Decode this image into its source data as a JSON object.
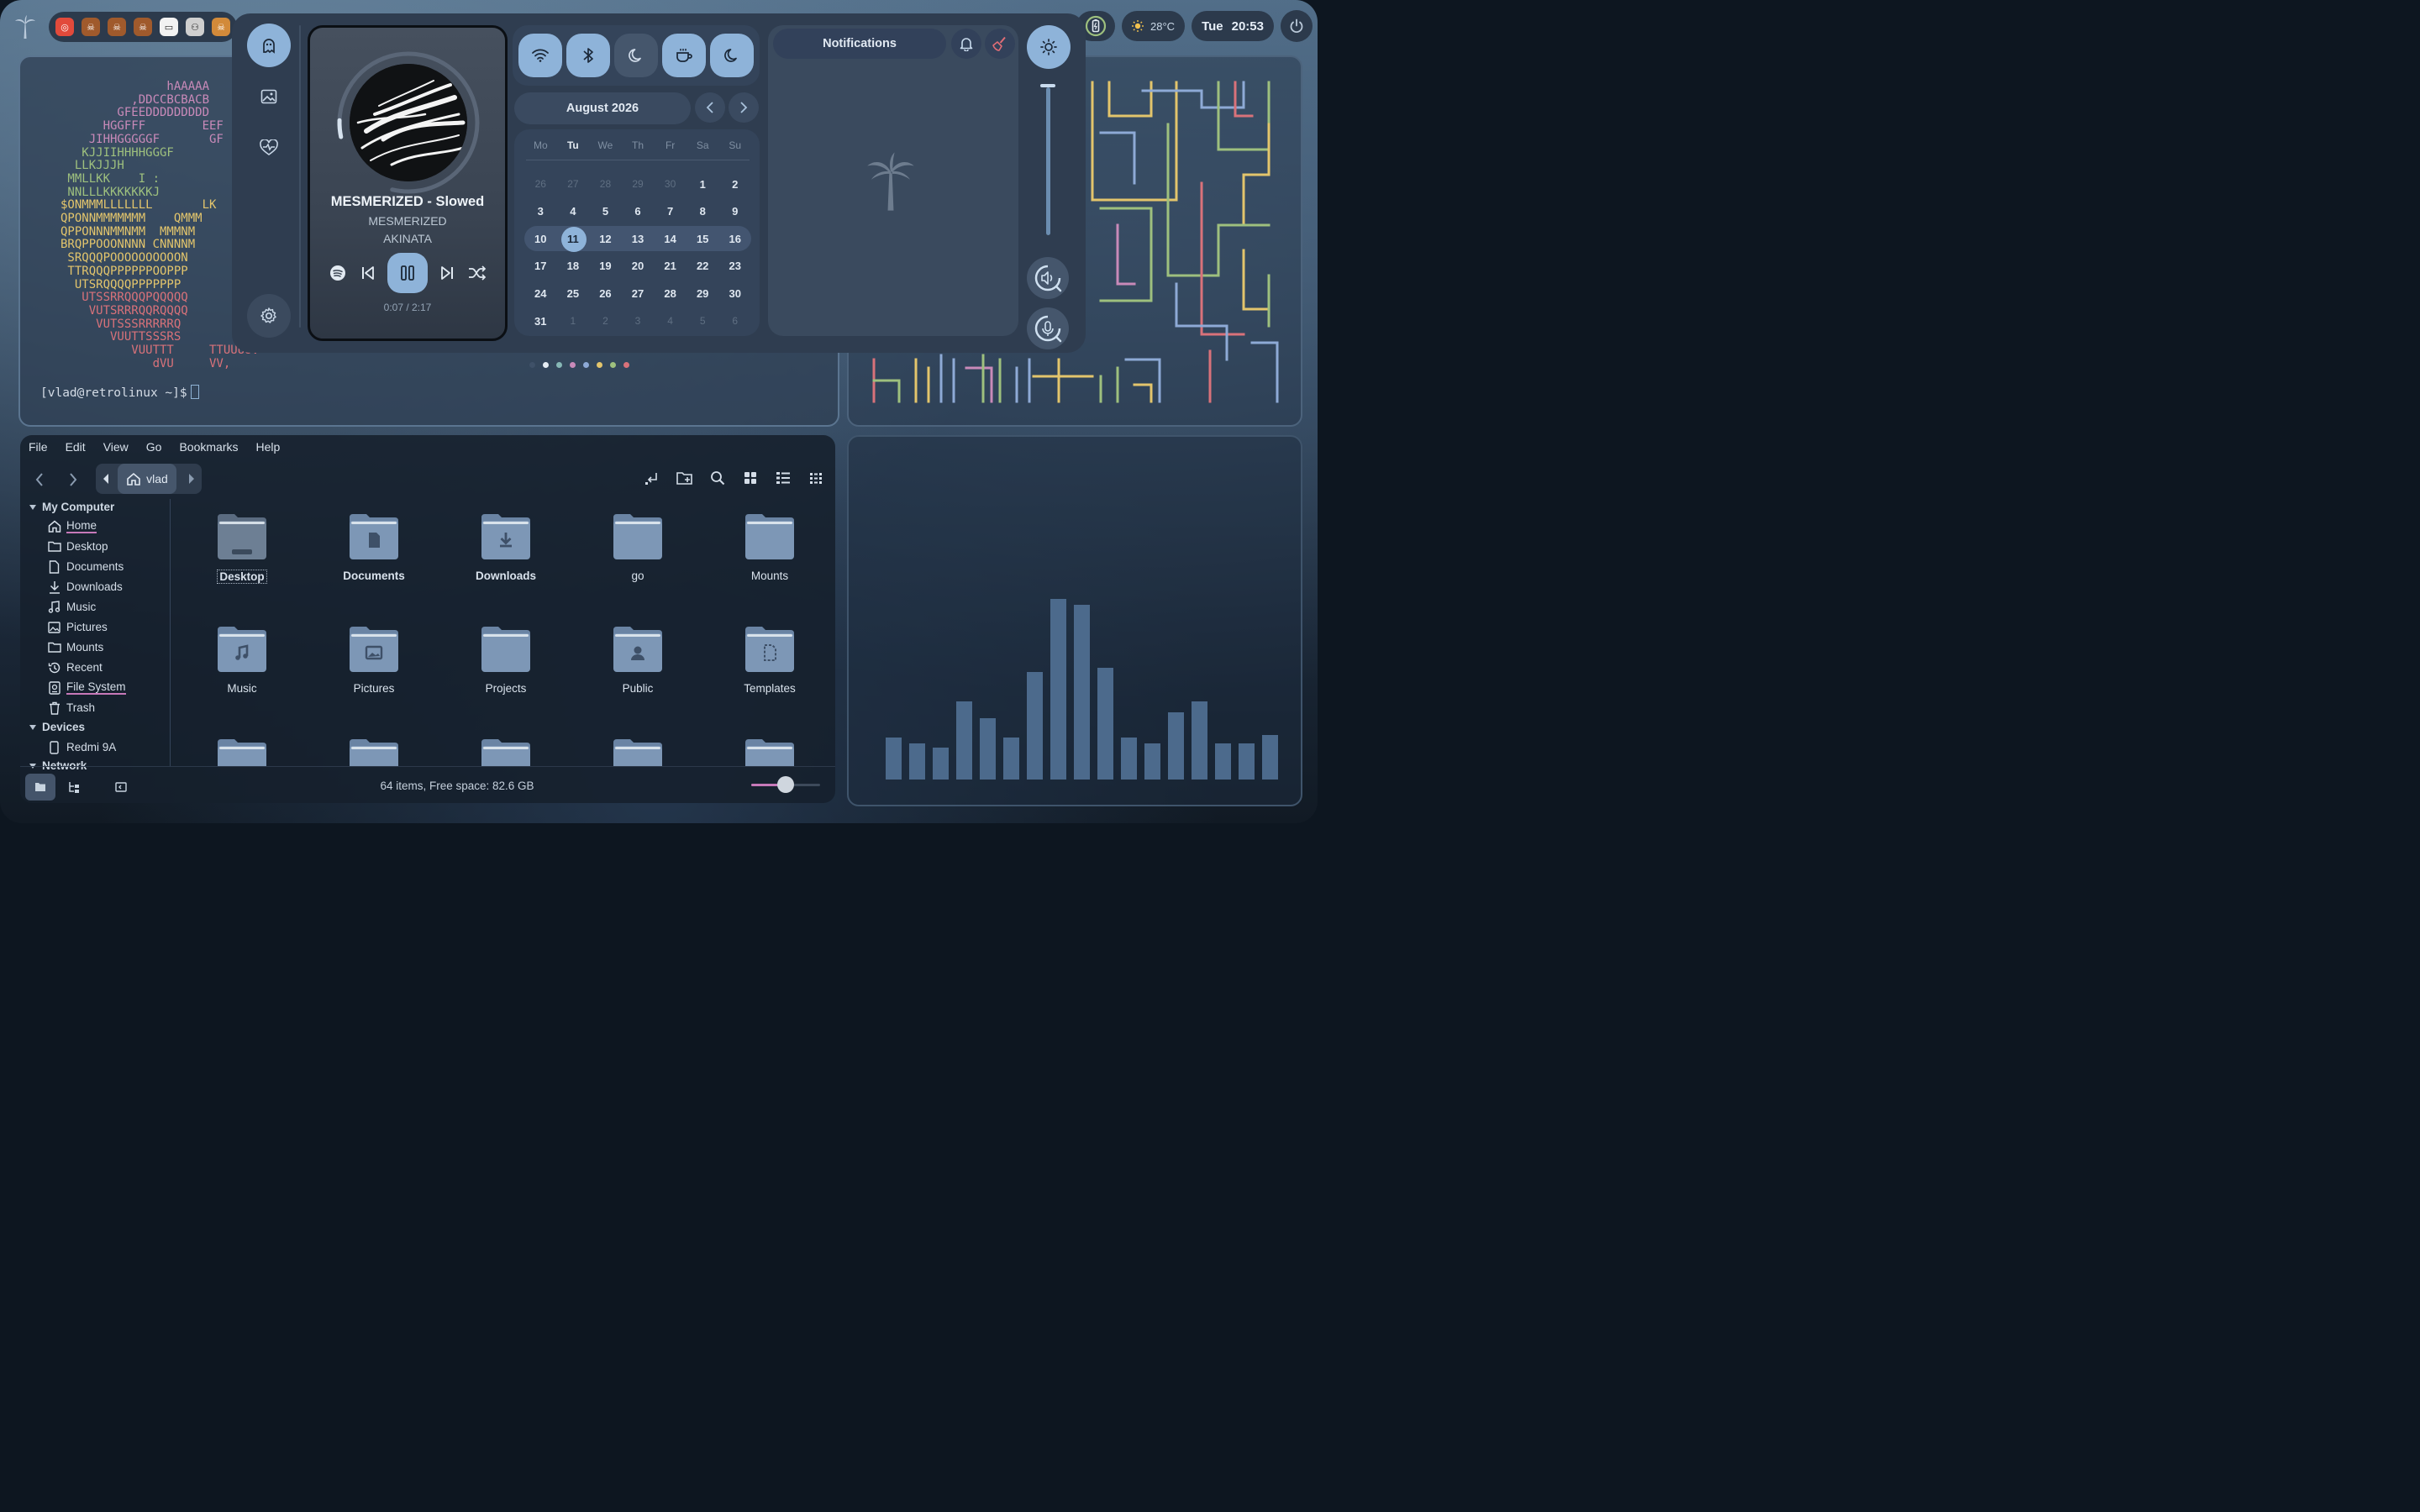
{
  "topbar": {
    "tray_apps": [
      {
        "name": "app-1",
        "color": "#e24a3b",
        "glyph": "◎"
      },
      {
        "name": "app-2",
        "color": "#a05a2c",
        "glyph": "☠"
      },
      {
        "name": "app-3",
        "color": "#a05a2c",
        "glyph": "☠"
      },
      {
        "name": "app-4",
        "color": "#a05a2c",
        "glyph": "☠"
      },
      {
        "name": "app-5",
        "color": "#f2f2f2",
        "glyph": "▭"
      },
      {
        "name": "app-6",
        "color": "#cfcfcf",
        "glyph": "⚇"
      },
      {
        "name": "app-7",
        "color": "#d28a3a",
        "glyph": "☠"
      }
    ],
    "weather": {
      "icon": "sun-icon",
      "temp": "28°C"
    },
    "clock": {
      "day": "Tue",
      "time": "20:53"
    }
  },
  "terminal": {
    "ascii_lines": [
      {
        "text": "               hAAAAA",
        "color": "#c98ab9"
      },
      {
        "text": "          ,DDCCBCBACB",
        "color": "#c98ab9"
      },
      {
        "text": "        GFEEDDDDDDDDD",
        "color": "#c98ab9"
      },
      {
        "text": "      HGGFFF        EEF",
        "color": "#c98ab9"
      },
      {
        "text": "    JIHHGGGGGF       GF",
        "color": "#c98ab9"
      },
      {
        "text": "   KJJIIHHHHGGGF",
        "color": "#9ec07e"
      },
      {
        "text": "  LLKJJJH",
        "color": "#9ec07e"
      },
      {
        "text": " MMLLKK    I :",
        "color": "#9ec07e"
      },
      {
        "text": " NNLLLKKKKKKKJ",
        "color": "#9ec07e"
      },
      {
        "text": "$ONMMMLLLLLLL       LK",
        "color": "#e3c56c"
      },
      {
        "text": "QPONNMMMMMMM    QMMM",
        "color": "#e3c56c"
      },
      {
        "text": "QPPONNNMMNMM  MMMNM",
        "color": "#e3c56c"
      },
      {
        "text": "BRQPPOOONNNN CNNNNM",
        "color": "#e3c56c"
      },
      {
        "text": " SRQQQPOOOOOOOOOON",
        "color": "#e3c56c"
      },
      {
        "text": " TTRQQQPPPPPPOOPPP",
        "color": "#e3c56c"
      },
      {
        "text": "  UTSRQQQQPPPPPPP",
        "color": "#e3c56c"
      },
      {
        "text": "   UTSSRRQQQPQQQQQ",
        "color": "#d9727a"
      },
      {
        "text": "    VUTSRRRQQRQQQQ",
        "color": "#d9727a"
      },
      {
        "text": "     VUTSSSRRRRRQ",
        "color": "#d9727a"
      },
      {
        "text": "       VUUTTSSSRS",
        "color": "#d9727a"
      },
      {
        "text": "          VUUTTT     TTUUUUV",
        "color": "#d9727a"
      },
      {
        "text": "             dVU     VV,",
        "color": "#d9727a"
      }
    ],
    "prompt": "[vlad@retrolinux ~]$"
  },
  "dashboard": {
    "player": {
      "title": "MESMERIZED - Slowed",
      "album": "MESMERIZED",
      "artist": "AKINATA",
      "time": "0:07 / 2:17",
      "progress": 0.05
    },
    "quick_toggles": [
      {
        "name": "wifi",
        "icon": "wifi-icon",
        "on": true
      },
      {
        "name": "bluetooth",
        "icon": "bluetooth-icon",
        "on": true
      },
      {
        "name": "night-light",
        "icon": "moon-icon",
        "on": false
      },
      {
        "name": "caffeine",
        "icon": "coffee-icon",
        "on": true
      },
      {
        "name": "do-not-disturb",
        "icon": "moon-icon",
        "on": true
      }
    ],
    "calendar": {
      "month_label": "August 2026",
      "dow": [
        "Mo",
        "Tu",
        "We",
        "Th",
        "Fr",
        "Sa",
        "Su"
      ],
      "today_dow_index": 1,
      "weeks": [
        [
          {
            "d": "26",
            "m": true
          },
          {
            "d": "27",
            "m": true
          },
          {
            "d": "28",
            "m": true
          },
          {
            "d": "29",
            "m": true
          },
          {
            "d": "30",
            "m": true
          },
          {
            "d": "1"
          },
          {
            "d": "2"
          }
        ],
        [
          {
            "d": "3"
          },
          {
            "d": "4"
          },
          {
            "d": "5"
          },
          {
            "d": "6"
          },
          {
            "d": "7"
          },
          {
            "d": "8"
          },
          {
            "d": "9"
          }
        ],
        [
          {
            "d": "10"
          },
          {
            "d": "11",
            "today": true
          },
          {
            "d": "12"
          },
          {
            "d": "13"
          },
          {
            "d": "14"
          },
          {
            "d": "15"
          },
          {
            "d": "16"
          }
        ],
        [
          {
            "d": "17"
          },
          {
            "d": "18"
          },
          {
            "d": "19"
          },
          {
            "d": "20"
          },
          {
            "d": "21"
          },
          {
            "d": "22"
          },
          {
            "d": "23"
          }
        ],
        [
          {
            "d": "24"
          },
          {
            "d": "25"
          },
          {
            "d": "26"
          },
          {
            "d": "27"
          },
          {
            "d": "28"
          },
          {
            "d": "29"
          },
          {
            "d": "30"
          }
        ],
        [
          {
            "d": "31"
          },
          {
            "d": "1",
            "m": true
          },
          {
            "d": "2",
            "m": true
          },
          {
            "d": "3",
            "m": true
          },
          {
            "d": "4",
            "m": true
          },
          {
            "d": "5",
            "m": true
          },
          {
            "d": "6",
            "m": true
          }
        ]
      ],
      "highlight_week": 2
    },
    "notifications": {
      "title": "Notifications"
    },
    "brightness_level": 0.92,
    "page_dots": [
      {
        "color": "#3f5168"
      },
      {
        "color": "#e6edf4"
      },
      {
        "color": "#86b7b5"
      },
      {
        "color": "#c98ab9"
      },
      {
        "color": "#8eaad6"
      },
      {
        "color": "#e3c56c"
      },
      {
        "color": "#9ec07e"
      },
      {
        "color": "#d9727a"
      }
    ]
  },
  "files": {
    "menu": [
      "File",
      "Edit",
      "View",
      "Go",
      "Bookmarks",
      "Help"
    ],
    "breadcrumb": "vlad",
    "sidebar": {
      "my_computer": "My Computer",
      "items": [
        {
          "label": "Home",
          "icon": "home-icon",
          "underline": true
        },
        {
          "label": "Desktop",
          "icon": "folder-icon"
        },
        {
          "label": "Documents",
          "icon": "document-icon"
        },
        {
          "label": "Downloads",
          "icon": "download-icon"
        },
        {
          "label": "Music",
          "icon": "music-icon"
        },
        {
          "label": "Pictures",
          "icon": "image-icon"
        },
        {
          "label": "Mounts",
          "icon": "folder-icon"
        },
        {
          "label": "Recent",
          "icon": "history-icon"
        },
        {
          "label": "File System",
          "icon": "drive-icon",
          "underline": true
        },
        {
          "label": "Trash",
          "icon": "trash-icon"
        }
      ],
      "devices": "Devices",
      "device_items": [
        {
          "label": "Redmi 9A",
          "icon": "phone-icon"
        }
      ],
      "network": "Network"
    },
    "folders": [
      {
        "label": "Desktop",
        "emblem": "desktop",
        "bold": true,
        "boxed": true
      },
      {
        "label": "Documents",
        "emblem": "document",
        "bold": true
      },
      {
        "label": "Downloads",
        "emblem": "download",
        "bold": true
      },
      {
        "label": "go",
        "emblem": ""
      },
      {
        "label": "Mounts",
        "emblem": ""
      },
      {
        "label": "Music",
        "emblem": "music"
      },
      {
        "label": "Pictures",
        "emblem": "image"
      },
      {
        "label": "Projects",
        "emblem": ""
      },
      {
        "label": "Public",
        "emblem": "person"
      },
      {
        "label": "Templates",
        "emblem": "template"
      },
      {
        "label": "",
        "emblem": ""
      },
      {
        "label": "",
        "emblem": ""
      },
      {
        "label": "",
        "emblem": ""
      },
      {
        "label": "",
        "emblem": ""
      },
      {
        "label": "",
        "emblem": ""
      }
    ],
    "status": "64 items, Free space: 82.6 GB",
    "zoom_level": 0.5
  },
  "visualizer": {
    "bars": [
      0.2,
      0.17,
      0.15,
      0.37,
      0.29,
      0.2,
      0.51,
      0.86,
      0.83,
      0.53,
      0.2,
      0.17,
      0.32,
      0.37,
      0.17,
      0.17,
      0.21
    ]
  }
}
